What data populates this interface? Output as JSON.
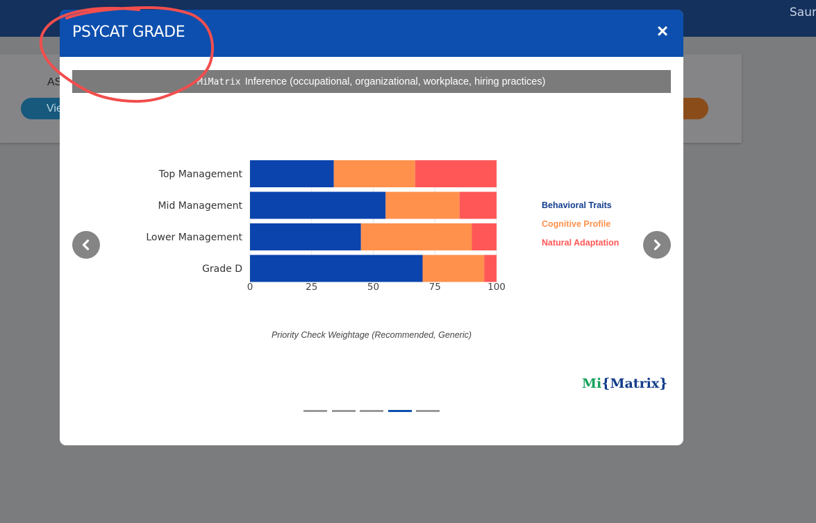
{
  "background": {
    "user_name_partial": "Saur",
    "card_label_partial": "AS",
    "card_button_partial": "Vie"
  },
  "modal": {
    "title": "PSYCAT GRADE",
    "close_label": "×",
    "banner_brand": "MiMatrix",
    "banner_text": "Inference (occupational, organizational, workplace, hiring practices)"
  },
  "chart_data": {
    "type": "bar",
    "orientation": "horizontal",
    "stacked": true,
    "categories": [
      "Top Management",
      "Mid Management",
      "Lower Management",
      "Grade D"
    ],
    "series": [
      {
        "name": "Behavioral Traits",
        "color": "#0b44ad",
        "values": [
          34,
          55,
          45,
          70
        ]
      },
      {
        "name": "Cognitive Profile",
        "color": "#ff914d",
        "values": [
          33,
          30,
          45,
          25
        ]
      },
      {
        "name": "Natural Adaptation",
        "color": "#ff5757",
        "values": [
          33,
          15,
          10,
          5
        ]
      }
    ],
    "xlim": [
      0,
      100
    ],
    "xticks": [
      "0",
      "25",
      "50",
      "75",
      "100"
    ],
    "caption": "Priority Check Weightage (Recommended, Generic)",
    "legend_position": "right",
    "grid": true
  },
  "logo": {
    "mi": "Mi",
    "matrix": "{Matrix}"
  },
  "carousel": {
    "slides": 5,
    "active_index": 3
  }
}
